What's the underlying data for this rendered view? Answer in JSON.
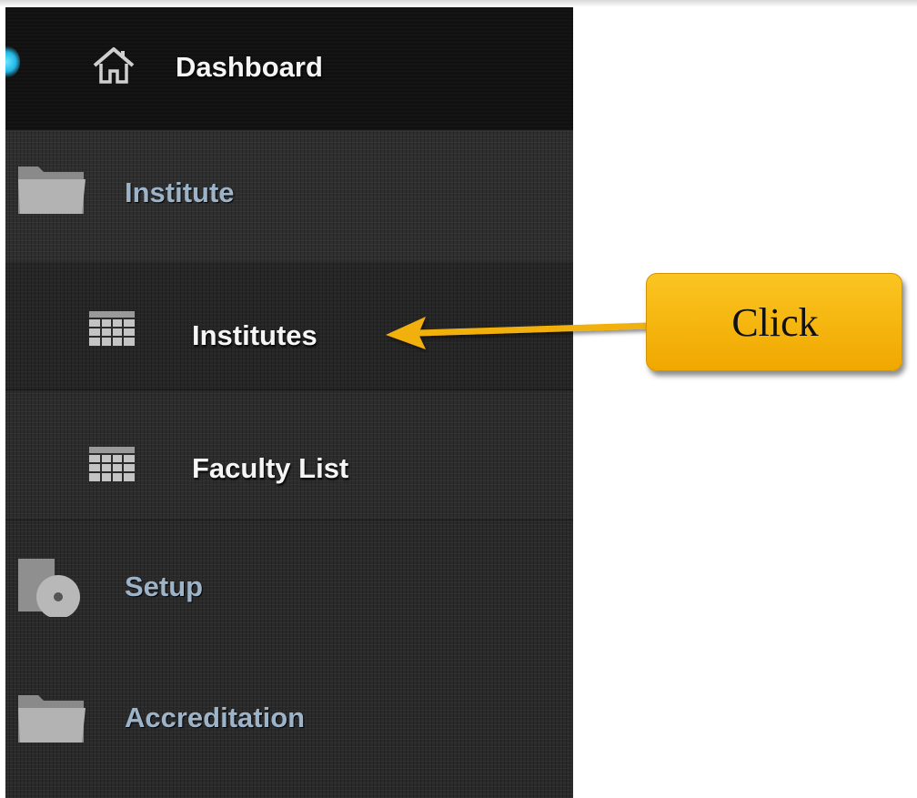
{
  "sidebar": {
    "items": [
      {
        "label": "Dashboard",
        "icon": "home-icon"
      },
      {
        "label": "Institute",
        "icon": "folder-icon"
      },
      {
        "label": "Institutes",
        "icon": "grid-table-icon"
      },
      {
        "label": "Faculty List",
        "icon": "grid-table-icon"
      },
      {
        "label": "Setup",
        "icon": "disc-icon"
      },
      {
        "label": "Accreditation",
        "icon": "folder-icon"
      }
    ]
  },
  "callout": {
    "text": "Click",
    "color": "#f5b40a"
  },
  "colors": {
    "sidebar_bg": "#2a2a2a",
    "active_glow": "#22b7e6",
    "section_label": "#9db3c8"
  }
}
